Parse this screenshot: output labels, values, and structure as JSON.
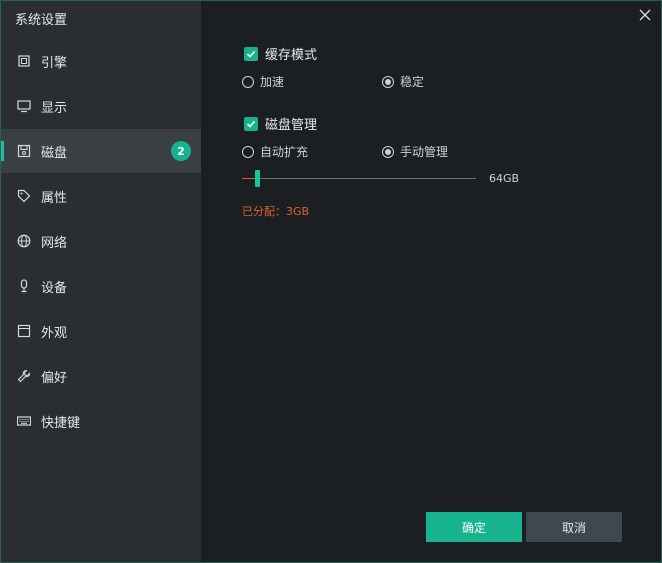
{
  "window": {
    "title": "系统设置"
  },
  "sidebar": {
    "items": [
      {
        "label": "引擎",
        "icon": "chip-icon"
      },
      {
        "label": "显示",
        "icon": "monitor-icon"
      },
      {
        "label": "磁盘",
        "icon": "disk-icon",
        "active": true,
        "badge": "2"
      },
      {
        "label": "属性",
        "icon": "tag-icon"
      },
      {
        "label": "网络",
        "icon": "globe-icon"
      },
      {
        "label": "设备",
        "icon": "microphone-icon"
      },
      {
        "label": "外观",
        "icon": "window-icon"
      },
      {
        "label": "偏好",
        "icon": "wrench-icon"
      },
      {
        "label": "快捷键",
        "icon": "keyboard-icon"
      }
    ]
  },
  "cache": {
    "label": "缓存模式",
    "checked": true,
    "options": [
      {
        "label": "加速",
        "selected": false
      },
      {
        "label": "稳定",
        "selected": true
      }
    ]
  },
  "disk_management": {
    "label": "磁盘管理",
    "checked": true,
    "options": [
      {
        "label": "自动扩充",
        "selected": false
      },
      {
        "label": "手动管理",
        "selected": true
      }
    ],
    "slider": {
      "value_gb": 3,
      "max_label": "64GB"
    },
    "allocated_text": "已分配：3GB"
  },
  "buttons": {
    "confirm": "确定",
    "cancel": "取消"
  },
  "colors": {
    "accent": "#18b38e",
    "warning": "#e0602f"
  }
}
